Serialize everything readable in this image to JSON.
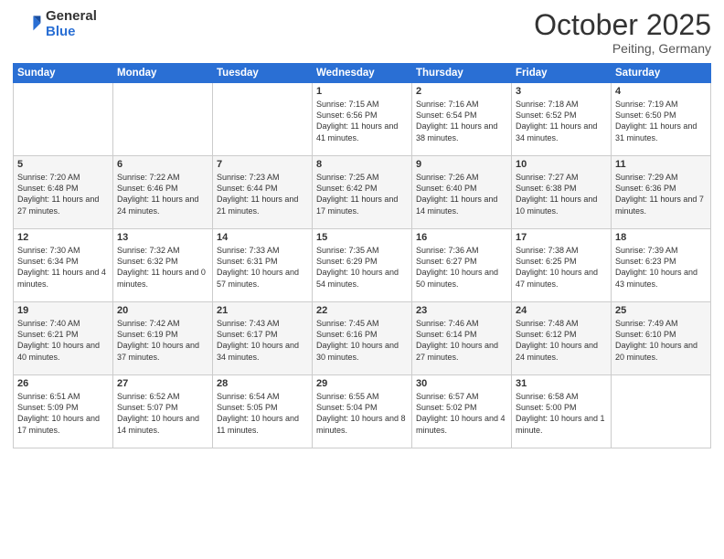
{
  "header": {
    "logo_general": "General",
    "logo_blue": "Blue",
    "month_title": "October 2025",
    "location": "Peiting, Germany"
  },
  "days_of_week": [
    "Sunday",
    "Monday",
    "Tuesday",
    "Wednesday",
    "Thursday",
    "Friday",
    "Saturday"
  ],
  "weeks": [
    [
      {
        "day": "",
        "info": ""
      },
      {
        "day": "",
        "info": ""
      },
      {
        "day": "",
        "info": ""
      },
      {
        "day": "1",
        "info": "Sunrise: 7:15 AM\nSunset: 6:56 PM\nDaylight: 11 hours and 41 minutes."
      },
      {
        "day": "2",
        "info": "Sunrise: 7:16 AM\nSunset: 6:54 PM\nDaylight: 11 hours and 38 minutes."
      },
      {
        "day": "3",
        "info": "Sunrise: 7:18 AM\nSunset: 6:52 PM\nDaylight: 11 hours and 34 minutes."
      },
      {
        "day": "4",
        "info": "Sunrise: 7:19 AM\nSunset: 6:50 PM\nDaylight: 11 hours and 31 minutes."
      }
    ],
    [
      {
        "day": "5",
        "info": "Sunrise: 7:20 AM\nSunset: 6:48 PM\nDaylight: 11 hours and 27 minutes."
      },
      {
        "day": "6",
        "info": "Sunrise: 7:22 AM\nSunset: 6:46 PM\nDaylight: 11 hours and 24 minutes."
      },
      {
        "day": "7",
        "info": "Sunrise: 7:23 AM\nSunset: 6:44 PM\nDaylight: 11 hours and 21 minutes."
      },
      {
        "day": "8",
        "info": "Sunrise: 7:25 AM\nSunset: 6:42 PM\nDaylight: 11 hours and 17 minutes."
      },
      {
        "day": "9",
        "info": "Sunrise: 7:26 AM\nSunset: 6:40 PM\nDaylight: 11 hours and 14 minutes."
      },
      {
        "day": "10",
        "info": "Sunrise: 7:27 AM\nSunset: 6:38 PM\nDaylight: 11 hours and 10 minutes."
      },
      {
        "day": "11",
        "info": "Sunrise: 7:29 AM\nSunset: 6:36 PM\nDaylight: 11 hours and 7 minutes."
      }
    ],
    [
      {
        "day": "12",
        "info": "Sunrise: 7:30 AM\nSunset: 6:34 PM\nDaylight: 11 hours and 4 minutes."
      },
      {
        "day": "13",
        "info": "Sunrise: 7:32 AM\nSunset: 6:32 PM\nDaylight: 11 hours and 0 minutes."
      },
      {
        "day": "14",
        "info": "Sunrise: 7:33 AM\nSunset: 6:31 PM\nDaylight: 10 hours and 57 minutes."
      },
      {
        "day": "15",
        "info": "Sunrise: 7:35 AM\nSunset: 6:29 PM\nDaylight: 10 hours and 54 minutes."
      },
      {
        "day": "16",
        "info": "Sunrise: 7:36 AM\nSunset: 6:27 PM\nDaylight: 10 hours and 50 minutes."
      },
      {
        "day": "17",
        "info": "Sunrise: 7:38 AM\nSunset: 6:25 PM\nDaylight: 10 hours and 47 minutes."
      },
      {
        "day": "18",
        "info": "Sunrise: 7:39 AM\nSunset: 6:23 PM\nDaylight: 10 hours and 43 minutes."
      }
    ],
    [
      {
        "day": "19",
        "info": "Sunrise: 7:40 AM\nSunset: 6:21 PM\nDaylight: 10 hours and 40 minutes."
      },
      {
        "day": "20",
        "info": "Sunrise: 7:42 AM\nSunset: 6:19 PM\nDaylight: 10 hours and 37 minutes."
      },
      {
        "day": "21",
        "info": "Sunrise: 7:43 AM\nSunset: 6:17 PM\nDaylight: 10 hours and 34 minutes."
      },
      {
        "day": "22",
        "info": "Sunrise: 7:45 AM\nSunset: 6:16 PM\nDaylight: 10 hours and 30 minutes."
      },
      {
        "day": "23",
        "info": "Sunrise: 7:46 AM\nSunset: 6:14 PM\nDaylight: 10 hours and 27 minutes."
      },
      {
        "day": "24",
        "info": "Sunrise: 7:48 AM\nSunset: 6:12 PM\nDaylight: 10 hours and 24 minutes."
      },
      {
        "day": "25",
        "info": "Sunrise: 7:49 AM\nSunset: 6:10 PM\nDaylight: 10 hours and 20 minutes."
      }
    ],
    [
      {
        "day": "26",
        "info": "Sunrise: 6:51 AM\nSunset: 5:09 PM\nDaylight: 10 hours and 17 minutes."
      },
      {
        "day": "27",
        "info": "Sunrise: 6:52 AM\nSunset: 5:07 PM\nDaylight: 10 hours and 14 minutes."
      },
      {
        "day": "28",
        "info": "Sunrise: 6:54 AM\nSunset: 5:05 PM\nDaylight: 10 hours and 11 minutes."
      },
      {
        "day": "29",
        "info": "Sunrise: 6:55 AM\nSunset: 5:04 PM\nDaylight: 10 hours and 8 minutes."
      },
      {
        "day": "30",
        "info": "Sunrise: 6:57 AM\nSunset: 5:02 PM\nDaylight: 10 hours and 4 minutes."
      },
      {
        "day": "31",
        "info": "Sunrise: 6:58 AM\nSunset: 5:00 PM\nDaylight: 10 hours and 1 minute."
      },
      {
        "day": "",
        "info": ""
      }
    ]
  ]
}
